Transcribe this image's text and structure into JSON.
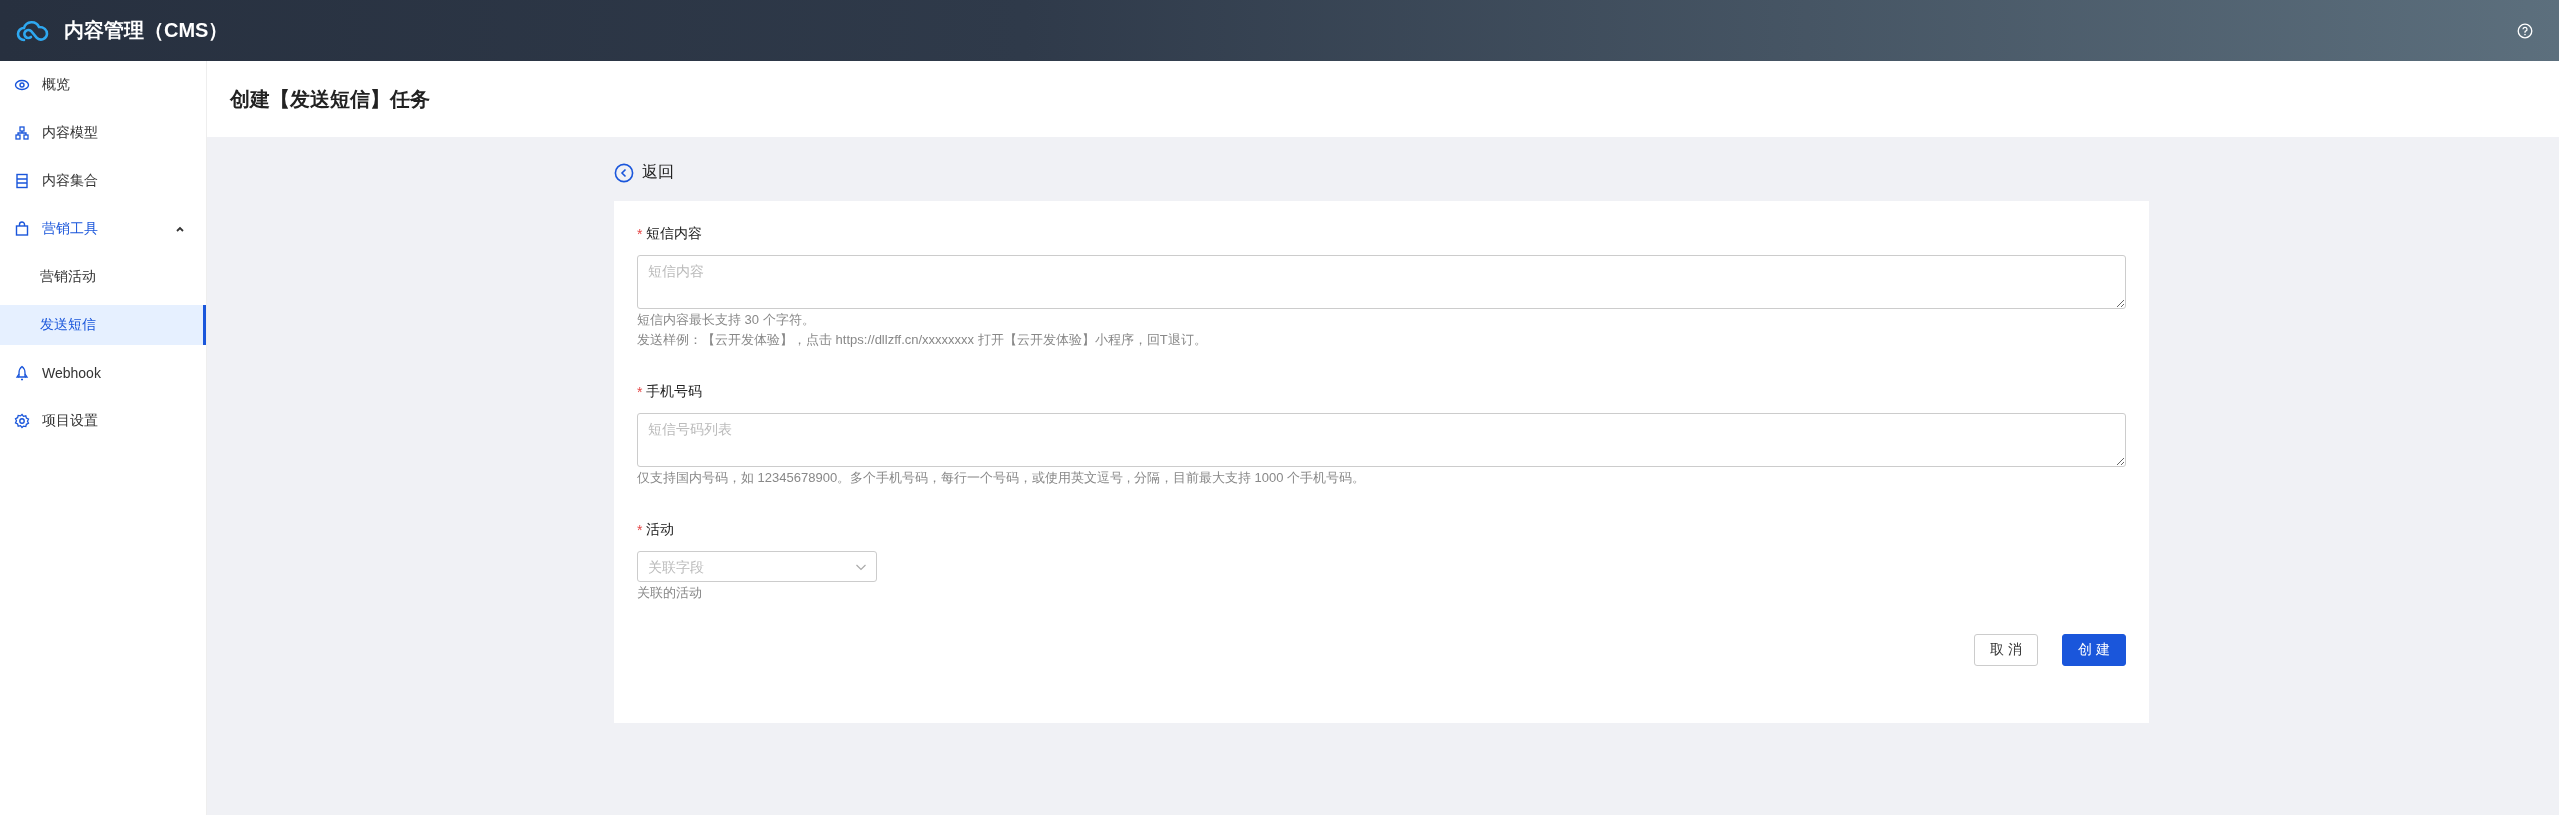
{
  "header": {
    "title": "内容管理（CMS）"
  },
  "sidebar": {
    "items": [
      {
        "label": "概览",
        "selected": false
      },
      {
        "label": "内容模型",
        "selected": false
      },
      {
        "label": "内容集合",
        "selected": false
      },
      {
        "label": "营销工具",
        "selected": false,
        "expanded": true,
        "children": [
          {
            "label": "营销活动",
            "selected": false
          },
          {
            "label": "发送短信",
            "selected": true
          }
        ]
      },
      {
        "label": "Webhook",
        "selected": false
      },
      {
        "label": "项目设置",
        "selected": false
      }
    ]
  },
  "page": {
    "title": "创建【发送短信】任务",
    "back": "返回"
  },
  "form": {
    "fields": [
      {
        "kind": "textarea",
        "label": "短信内容",
        "required_mark": "*",
        "placeholder": "短信内容",
        "help": [
          "短信内容最长支持 30 个字符。",
          "发送样例：【云开发体验】，点击 https://dllzff.cn/xxxxxxxx 打开【云开发体验】小程序，回T退订。"
        ]
      },
      {
        "kind": "textarea",
        "label": "手机号码",
        "required_mark": "*",
        "placeholder": "短信号码列表",
        "help": [
          "仅支持国内号码，如 12345678900。多个手机号码，每行一个号码，或使用英文逗号 , 分隔，目前最大支持 1000 个手机号码。"
        ]
      },
      {
        "kind": "select",
        "label": "活动",
        "required_mark": "*",
        "placeholder": "关联字段",
        "help": [
          "关联的活动"
        ]
      }
    ],
    "buttons": [
      {
        "label": "取 消",
        "kind": "secondary"
      },
      {
        "label": "创 建",
        "kind": "primary"
      }
    ]
  }
}
